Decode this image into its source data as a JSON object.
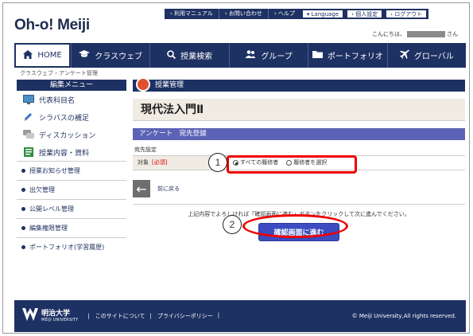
{
  "header": {
    "logo": "Oh-o! Meiji",
    "top_links": [
      "› 利用マニュアル",
      "› お問い合わせ",
      "› ヘルプ"
    ],
    "top_buttons": [
      "▾ Language",
      "› 個人設定",
      "› ログアウト"
    ],
    "greeting_prefix": "こんにちは、",
    "greeting_suffix": "さん"
  },
  "nav": {
    "items": [
      {
        "label": "HOME",
        "icon": "home-icon",
        "active": true
      },
      {
        "label": "クラスウェブ",
        "icon": "graduation-cap-icon"
      },
      {
        "label": "授業検索",
        "icon": "search-icon"
      },
      {
        "label": "グループ",
        "icon": "group-icon"
      },
      {
        "label": "ポートフォリオ",
        "icon": "folder-icon"
      },
      {
        "label": "グローバル",
        "icon": "airplane-icon"
      }
    ]
  },
  "breadcrumb": "クラスウェブ › アンケート管理",
  "sidebar": {
    "heading": "編集メニュー",
    "main_items": [
      {
        "label": "代表科目名",
        "icon": "monitor-icon"
      },
      {
        "label": "シラバスの補足",
        "icon": "pencil-icon"
      },
      {
        "label": "ディスカッション",
        "icon": "chat-icon"
      },
      {
        "label": "授業内容・資料",
        "icon": "document-icon"
      }
    ],
    "small_items": [
      "授業お知らせ管理",
      "出欠管理",
      "公開レベル管理",
      "編集権限管理",
      "ポートフォリオ(学習履歴)"
    ]
  },
  "main": {
    "section_title": "授業管理",
    "course_name": "現代法入門Ⅱ",
    "subheading": "アンケート　宛先登録",
    "settings_label": "宛先設定",
    "target_label": "対象",
    "required": "[必須]",
    "option_all": "すべての履修者",
    "option_select": "履修者を選択",
    "back_label": "前に戻る",
    "instruction": "上記内容でよろしければ「確認画面に進む」ボタンをクリックして次に進んでください。",
    "confirm_button": "確認画面に進む"
  },
  "annotations": {
    "circle1": "1",
    "circle2": "2"
  },
  "footer": {
    "univ_name": "明治大学",
    "univ_en": "MEIJI UNIVERSITY",
    "links": [
      "|　このサイトについて",
      "|　プライバシーポリシー",
      "|"
    ],
    "copyright": "© Meiji University,All rights reserved."
  },
  "colors": {
    "navy": "#1e3163",
    "accent": "#5c62b5",
    "button": "#3c4cc0",
    "highlight": "#e00000"
  }
}
